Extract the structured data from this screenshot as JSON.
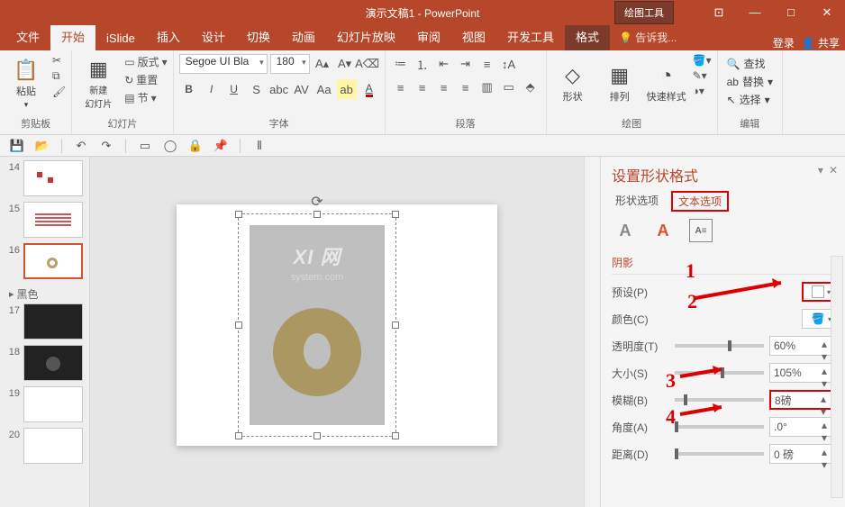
{
  "title": "演示文稿1 - PowerPoint",
  "contextTab": "绘图工具",
  "winbtns": {
    "restore": "⊡",
    "min": "—",
    "max": "□",
    "close": "✕"
  },
  "tabs": {
    "file": "文件",
    "home": "开始",
    "islide": "iSlide",
    "insert": "插入",
    "design": "设计",
    "transition": "切换",
    "anim": "动画",
    "show": "幻灯片放映",
    "review": "审阅",
    "view": "视图",
    "dev": "开发工具",
    "format": "格式"
  },
  "tellme": "告诉我...",
  "login": "登录",
  "share": "共享",
  "ribbon": {
    "paste": "粘贴",
    "clipboard": "剪贴板",
    "newslide": "新建\n幻灯片",
    "layout": "版式",
    "reset": "重置",
    "section": "节",
    "slides": "幻灯片",
    "fontname": "Segoe UI Bla",
    "fontsize": "180",
    "fontgrp": "字体",
    "paragrp": "段落",
    "shape": "形状",
    "arrange": "排列",
    "quickstyle": "快速样式",
    "drawgrp": "绘图",
    "find": "查找",
    "replace": "替换",
    "select": "选择",
    "editgrp": "编辑"
  },
  "thumbs": {
    "n14": "14",
    "n15": "15",
    "n16": "16",
    "sec": "黑色",
    "n17": "17",
    "n18": "18",
    "n19": "19",
    "n20": "20"
  },
  "watermark": {
    "l1": "XI 网",
    "l2": "system.com"
  },
  "pane": {
    "title": "设置形状格式",
    "shapeopt": "形状选项",
    "textopt": "文本选项",
    "shadow": "阴影",
    "preset": "预设(P)",
    "color": "颜色(C)",
    "transparency": "透明度(T)",
    "transp_val": "60%",
    "size": "大小(S)",
    "size_val": "105%",
    "blur": "模糊(B)",
    "blur_val": "8磅",
    "angle": "角度(A)",
    "angle_val": ".0°",
    "distance": "距离(D)",
    "dist_val": "0 磅"
  },
  "annot": {
    "n1": "1",
    "n2": "2",
    "n3": "3",
    "n4": "4"
  }
}
